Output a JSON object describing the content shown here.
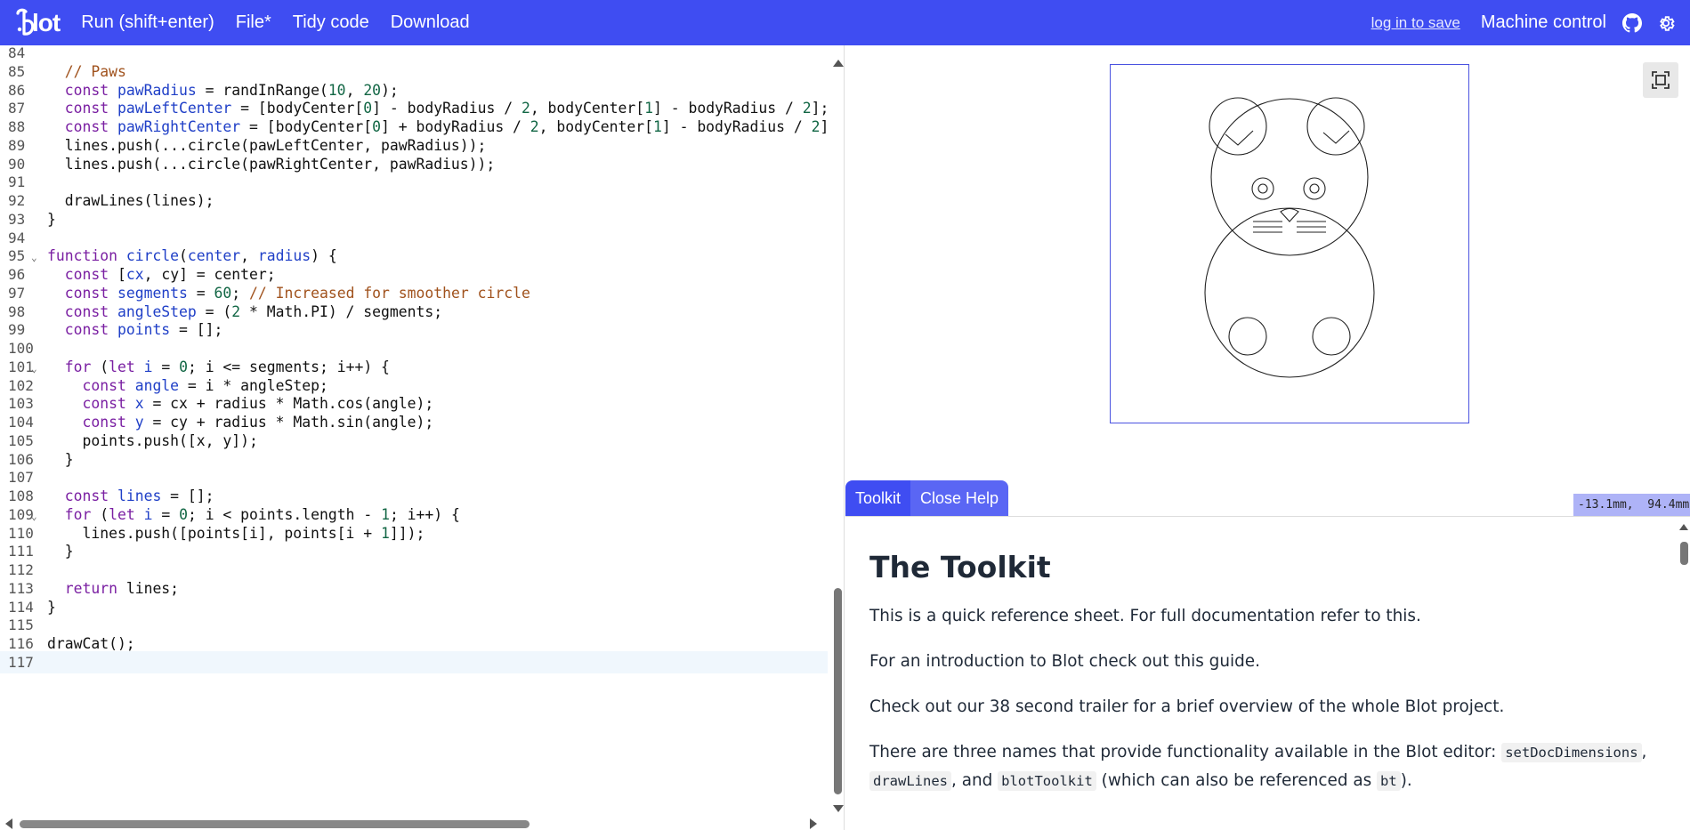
{
  "header": {
    "logo_text": "lot",
    "run_label": "Run (shift+enter)",
    "file_label": "File*",
    "tidy_label": "Tidy code",
    "download_label": "Download",
    "login_label": "log in to save",
    "machine_label": "Machine control",
    "github_icon": "github-icon",
    "settings_icon": "gear-icon",
    "bar_color": "#3f4df2"
  },
  "editor": {
    "lines": [
      {
        "n": "84",
        "code": ""
      },
      {
        "n": "85",
        "code": "  // Paws"
      },
      {
        "n": "86",
        "code": "  const pawRadius = randInRange(10, 20);"
      },
      {
        "n": "87",
        "code": "  const pawLeftCenter = [bodyCenter[0] - bodyRadius / 2, bodyCenter[1] - bodyRadius / 2];"
      },
      {
        "n": "88",
        "code": "  const pawRightCenter = [bodyCenter[0] + bodyRadius / 2, bodyCenter[1] - bodyRadius / 2]"
      },
      {
        "n": "89",
        "code": "  lines.push(...circle(pawLeftCenter, pawRadius));"
      },
      {
        "n": "90",
        "code": "  lines.push(...circle(pawRightCenter, pawRadius));"
      },
      {
        "n": "91",
        "code": ""
      },
      {
        "n": "92",
        "code": "  drawLines(lines);"
      },
      {
        "n": "93",
        "code": "}"
      },
      {
        "n": "94",
        "code": ""
      },
      {
        "n": "95",
        "code": "function circle(center, radius) {",
        "fold": true
      },
      {
        "n": "96",
        "code": "  const [cx, cy] = center;"
      },
      {
        "n": "97",
        "code": "  const segments = 60; // Increased for smoother circle"
      },
      {
        "n": "98",
        "code": "  const angleStep = (2 * Math.PI) / segments;"
      },
      {
        "n": "99",
        "code": "  const points = [];"
      },
      {
        "n": "100",
        "code": ""
      },
      {
        "n": "101",
        "code": "  for (let i = 0; i <= segments; i++) {",
        "fold": true
      },
      {
        "n": "102",
        "code": "    const angle = i * angleStep;"
      },
      {
        "n": "103",
        "code": "    const x = cx + radius * Math.cos(angle);"
      },
      {
        "n": "104",
        "code": "    const y = cy + radius * Math.sin(angle);"
      },
      {
        "n": "105",
        "code": "    points.push([x, y]);"
      },
      {
        "n": "106",
        "code": "  }"
      },
      {
        "n": "107",
        "code": ""
      },
      {
        "n": "108",
        "code": "  const lines = [];"
      },
      {
        "n": "109",
        "code": "  for (let i = 0; i < points.length - 1; i++) {",
        "fold": true
      },
      {
        "n": "110",
        "code": "    lines.push([points[i], points[i + 1]]);"
      },
      {
        "n": "111",
        "code": "  }"
      },
      {
        "n": "112",
        "code": ""
      },
      {
        "n": "113",
        "code": "  return lines;"
      },
      {
        "n": "114",
        "code": "}"
      },
      {
        "n": "115",
        "code": ""
      },
      {
        "n": "116",
        "code": "drawCat();"
      },
      {
        "n": "117",
        "code": "",
        "active": true
      }
    ]
  },
  "viewer": {
    "coords": "-13.1mm,  94.4mm",
    "fit_icon": "fit-screen-icon"
  },
  "tabs": {
    "toolkit": "Toolkit",
    "close_help": "Close Help"
  },
  "help": {
    "title": "The Toolkit",
    "p1": "This is a quick reference sheet. For full documentation refer to this.",
    "p2": "For an introduction to Blot check out this guide.",
    "p3": "Check out our 38 second trailer for a brief overview of the whole Blot project.",
    "p4_a": "There are three names that provide functionality available in the Blot editor: ",
    "p4_code1": "setDocDimensions",
    "p4_b": ",",
    "p4_code2": "drawLines",
    "p4_c": ", and ",
    "p4_code3": "blotToolkit",
    "p4_d": " (which can also be referenced as ",
    "p4_code4": "bt",
    "p4_e": ")."
  }
}
